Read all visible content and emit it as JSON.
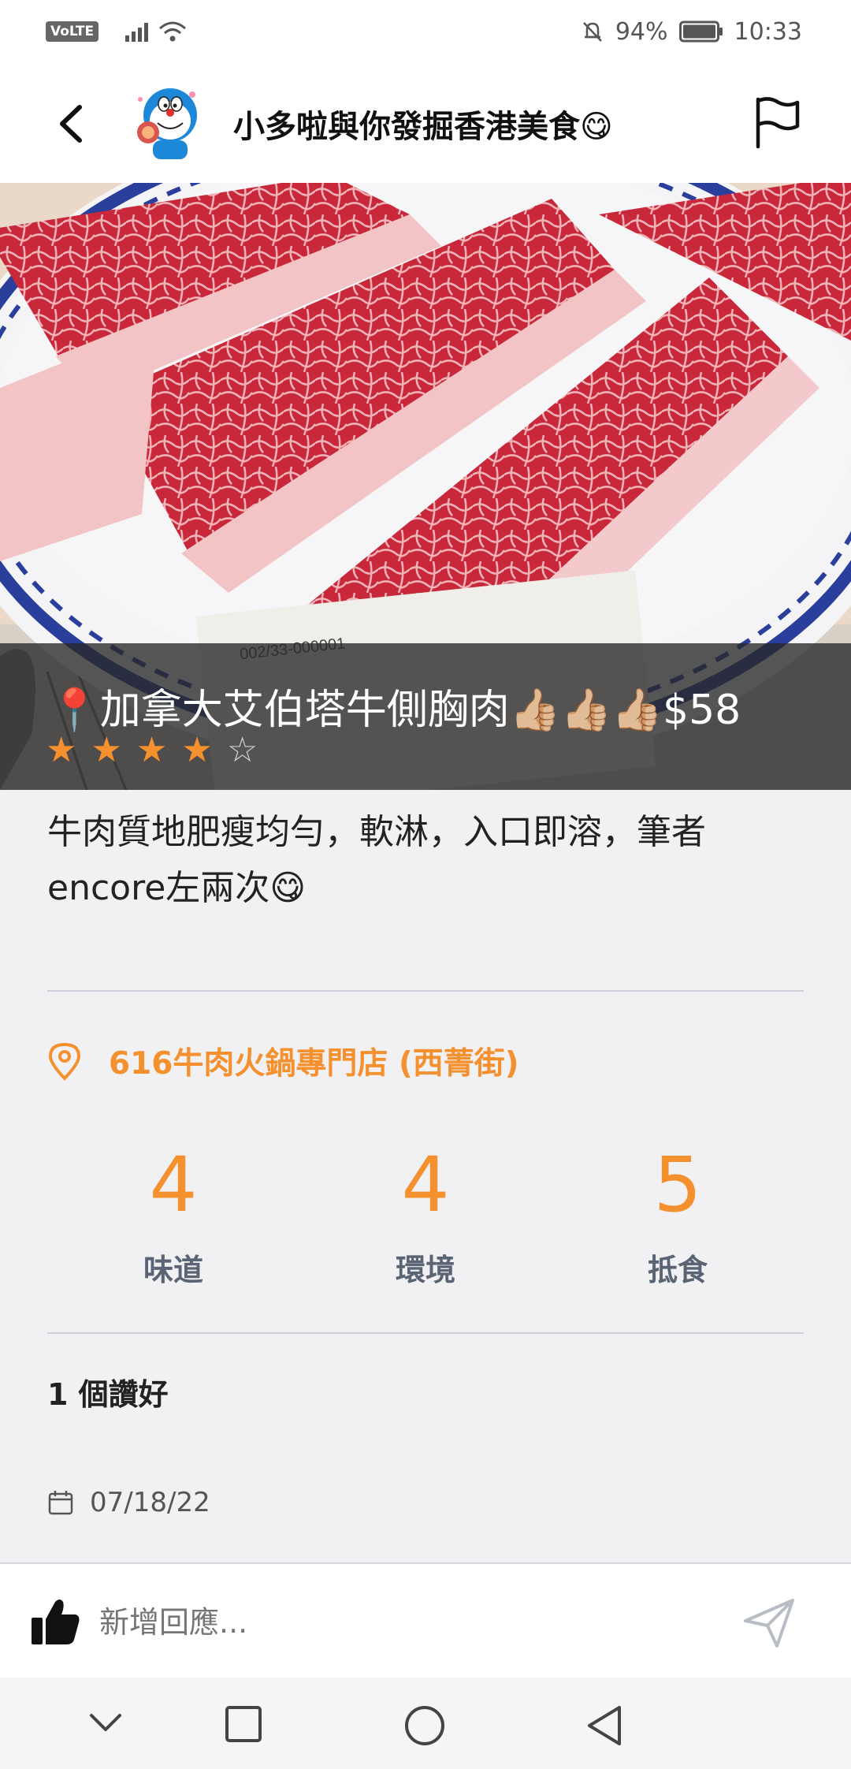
{
  "status_bar": {
    "network_badge": "VoLTE",
    "battery_text": "94%",
    "time": "10:33",
    "icons": [
      "signal-icon",
      "wifi-icon",
      "mute-bell-icon",
      "battery-icon"
    ]
  },
  "header": {
    "title": "小多啦與你發掘香港美食😋",
    "back_icon": "chevron-left-icon",
    "report_icon": "flag-icon"
  },
  "post": {
    "dish_title": "📍加拿大艾伯塔牛側胸肉👍🏼👍🏼👍🏼$58",
    "star_rating": 4,
    "star_max": 5,
    "review_text": "牛肉質地肥瘦均勻，軟淋，入口即溶，筆者encore左兩次😋",
    "restaurant": "616牛肉火鍋專門店 (西菁街)",
    "ratings": [
      {
        "label": "味道",
        "value": "4"
      },
      {
        "label": "環境",
        "value": "4"
      },
      {
        "label": "抵食",
        "value": "5"
      }
    ],
    "likes_text": "1 個讚好",
    "date": "07/18/22"
  },
  "comment": {
    "placeholder": "新增回應..."
  },
  "nav": {
    "icons": [
      "collapse-down-icon",
      "recent-apps-icon",
      "home-icon",
      "back-icon"
    ]
  },
  "colors": {
    "accent": "#f5902e",
    "background": "#f1f1f3"
  }
}
